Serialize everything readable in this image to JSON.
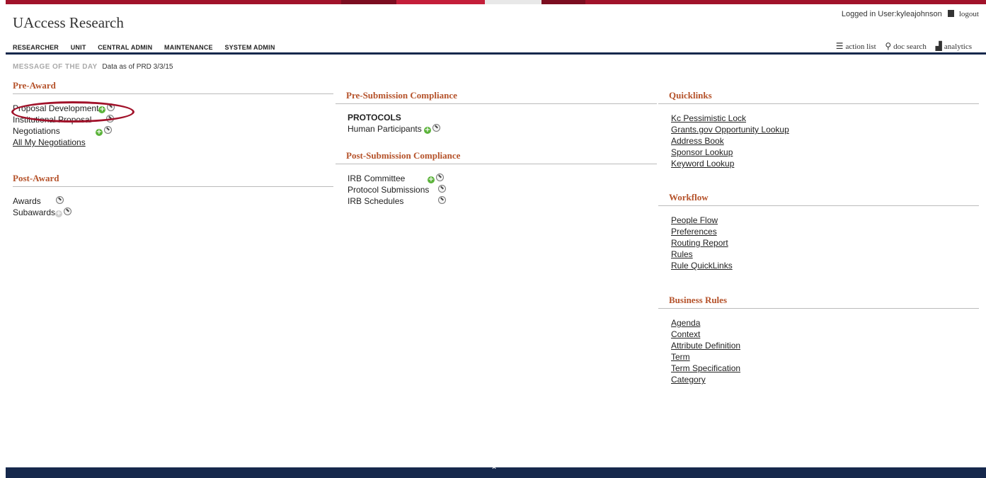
{
  "app": {
    "title": "UAccess Research"
  },
  "user": {
    "logged_in_text": "Logged in User:kyleajohnson",
    "logout_label": "logout"
  },
  "nav": {
    "items": [
      "RESEARCHER",
      "UNIT",
      "CENTRAL ADMIN",
      "MAINTENANCE",
      "SYSTEM ADMIN"
    ]
  },
  "tools": {
    "action_list": "action list",
    "doc_search": "doc search",
    "analytics": "analytics"
  },
  "motd": {
    "label": "MESSAGE OF THE DAY",
    "text": "Data as of PRD 3/3/15"
  },
  "pre_award": {
    "title": "Pre-Award",
    "items": [
      "Proposal Development",
      "Institutional Proposal",
      "Negotiations"
    ],
    "link": "All My Negotiations"
  },
  "post_award": {
    "title": "Post-Award",
    "items": [
      "Awards",
      "Subawards"
    ]
  },
  "pre_submission": {
    "title": "Pre-Submission Compliance",
    "subheading": "PROTOCOLS",
    "items": [
      "Human Participants"
    ]
  },
  "post_submission": {
    "title": "Post-Submission Compliance",
    "items": [
      "IRB Committee",
      "Protocol Submissions",
      "IRB Schedules"
    ]
  },
  "quicklinks": {
    "title": "Quicklinks",
    "links": [
      "Kc Pessimistic Lock",
      "Grants.gov Opportunity Lookup",
      "Address Book",
      "Sponsor Lookup",
      "Keyword Lookup"
    ]
  },
  "workflow": {
    "title": "Workflow",
    "links": [
      "People Flow",
      "Preferences",
      "Routing Report",
      "Rules",
      "Rule QuickLinks"
    ]
  },
  "business_rules": {
    "title": "Business Rules",
    "links": [
      "Agenda",
      "Context",
      "Attribute Definition",
      "Term",
      "Term Specification",
      "Category"
    ]
  },
  "colors": {
    "brand_red": "#a1122a",
    "navy": "#16284c",
    "section_heading": "#b5522a"
  }
}
